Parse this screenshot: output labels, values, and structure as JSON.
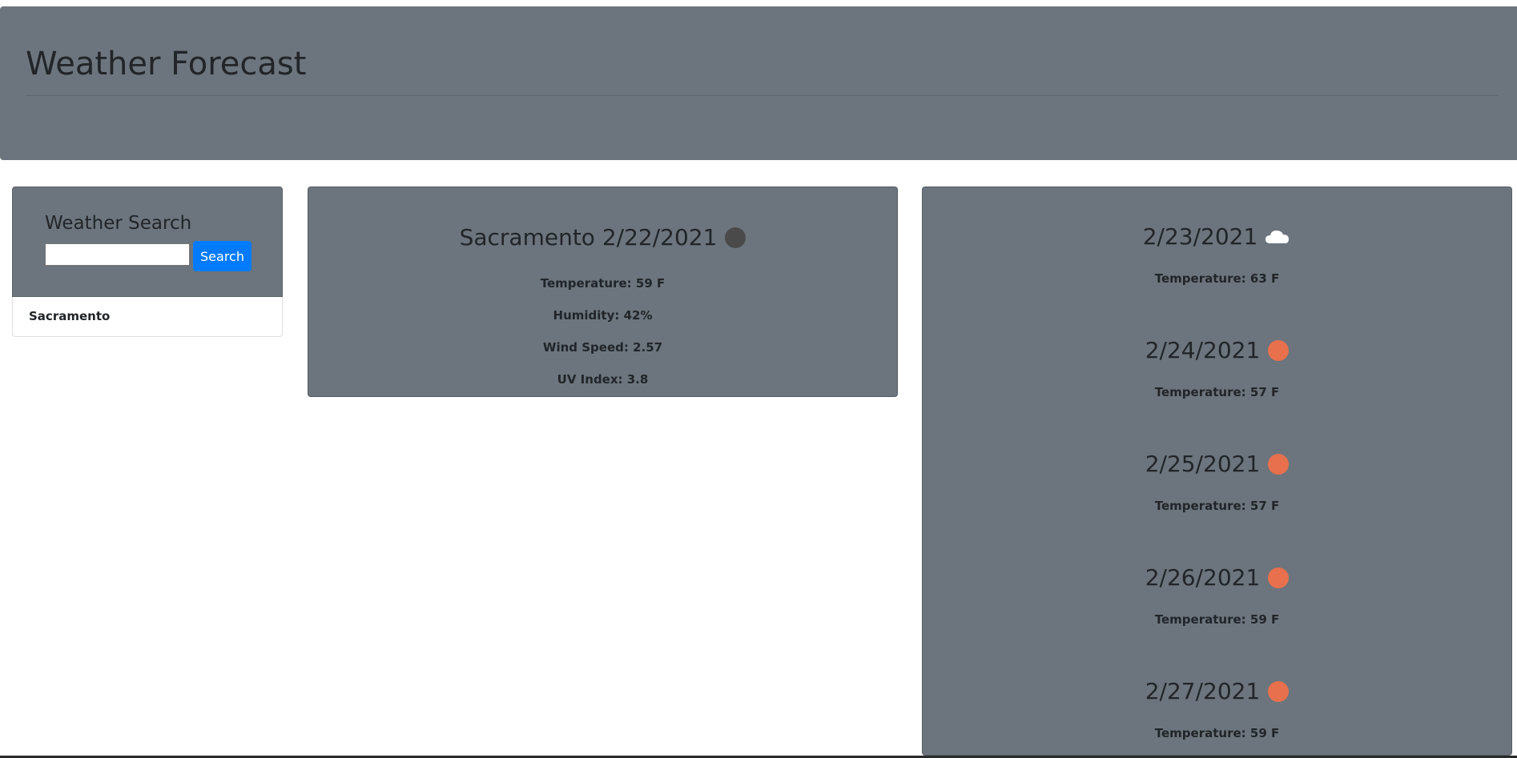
{
  "header": {
    "title": "Weather Forecast"
  },
  "search": {
    "heading": "Weather Search",
    "input_value": "",
    "button_label": "Search",
    "history": [
      "Sacramento"
    ]
  },
  "current": {
    "title": "Sacramento 2/22/2021",
    "icon": "dark-circle-icon",
    "temperature": "Temperature: 59 F",
    "humidity": "Humidity: 42%",
    "wind": "Wind Speed: 2.57",
    "uv": "UV Index: 3.8"
  },
  "forecast": [
    {
      "date": "2/23/2021",
      "icon": "cloud-icon",
      "temperature": "Temperature: 63 F"
    },
    {
      "date": "2/24/2021",
      "icon": "sun-icon",
      "temperature": "Temperature: 57 F"
    },
    {
      "date": "2/25/2021",
      "icon": "sun-icon",
      "temperature": "Temperature: 57 F"
    },
    {
      "date": "2/26/2021",
      "icon": "sun-icon",
      "temperature": "Temperature: 59 F"
    },
    {
      "date": "2/27/2021",
      "icon": "sun-icon",
      "temperature": "Temperature: 59 F"
    }
  ],
  "colors": {
    "panel": "#6c757d",
    "accent": "#007bff",
    "sun": "#e8704d",
    "dark_icon": "#4a4a4a"
  }
}
